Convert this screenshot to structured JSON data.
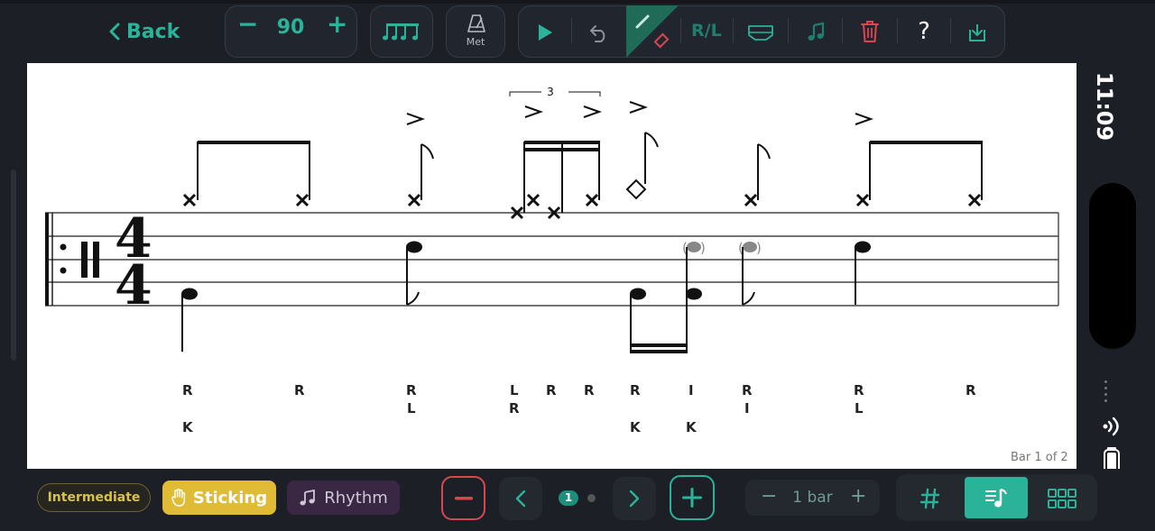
{
  "toolbar": {
    "back_label": "Back",
    "tempo_value": "90",
    "tempo_minus": "−",
    "tempo_plus": "+",
    "metronome_label": "Met",
    "rl_label": "R/L",
    "help_label": "?",
    "icons": [
      "chevron-left-icon",
      "beamed-notes-icon",
      "metronome-icon",
      "play-icon",
      "undo-icon",
      "pencil-icon",
      "eraser-icon",
      "tray-icon",
      "notes-icon",
      "trash-icon",
      "export-icon"
    ],
    "accent_color": "#2bb39a",
    "delete_color": "#d9464f"
  },
  "score": {
    "time_signature_top": "4",
    "time_signature_bottom": "4",
    "tuplet_label": "3",
    "bar_indicator": "Bar 1 of 2",
    "sticking_row1": [
      "R",
      "R",
      "R",
      "L",
      "R",
      "R",
      "R",
      "I",
      "R",
      "R",
      "R"
    ],
    "sticking_row2": [
      "L",
      "R",
      "I",
      "L"
    ],
    "sticking_row3": [
      "K",
      "K",
      "K"
    ]
  },
  "side": {
    "time": "11:09"
  },
  "bottom": {
    "level_label": "Intermediate",
    "sticking_label": "Sticking",
    "rhythm_label": "Rhythm",
    "page_current": "1",
    "bar_length_label": "1 bar",
    "bar_minus": "−",
    "bar_plus": "+",
    "level_color": "#d9c24a",
    "sticking_color": "#e0bb35",
    "rhythm_color": "#3a2744"
  }
}
